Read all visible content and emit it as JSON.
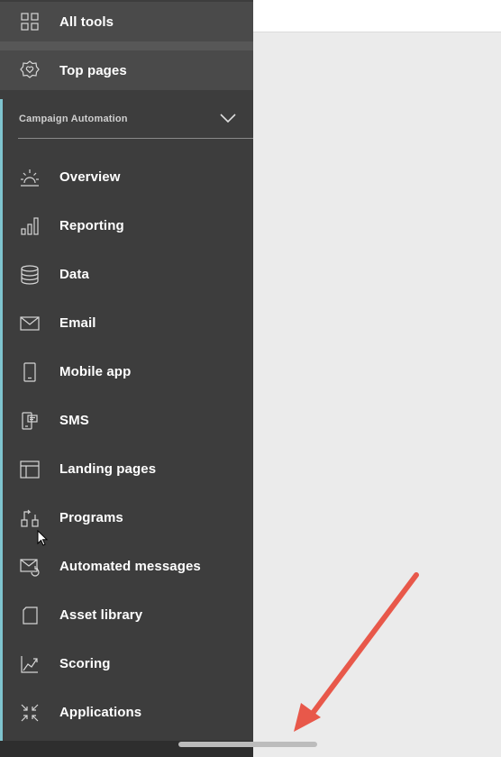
{
  "sidebar": {
    "top_items": [
      {
        "label": "All tools",
        "icon": "grid-icon"
      },
      {
        "label": "Top pages",
        "icon": "heart-badge-icon"
      }
    ],
    "section": {
      "title": "Campaign Automation",
      "expanded": true
    },
    "items": [
      {
        "label": "Overview",
        "icon": "sunrise-icon"
      },
      {
        "label": "Reporting",
        "icon": "bar-chart-icon"
      },
      {
        "label": "Data",
        "icon": "database-icon"
      },
      {
        "label": "Email",
        "icon": "envelope-icon"
      },
      {
        "label": "Mobile app",
        "icon": "mobile-phone-icon"
      },
      {
        "label": "SMS",
        "icon": "sms-icon"
      },
      {
        "label": "Landing pages",
        "icon": "layout-icon"
      },
      {
        "label": "Programs",
        "icon": "program-flow-icon"
      },
      {
        "label": "Automated messages",
        "icon": "automated-envelope-icon"
      },
      {
        "label": "Asset library",
        "icon": "asset-icon"
      },
      {
        "label": "Scoring",
        "icon": "trend-chart-icon"
      },
      {
        "label": "Applications",
        "icon": "collapse-arrows-icon"
      }
    ]
  },
  "colors": {
    "sidebar_bg": "#3d3d3d",
    "accent_rail": "#7fc4cf",
    "annotation_arrow": "#e8584a"
  }
}
